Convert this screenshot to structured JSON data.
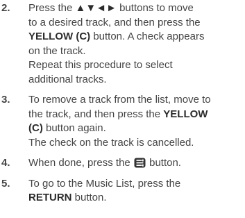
{
  "steps": [
    {
      "number": "2.",
      "text_a": "Press the ",
      "arrows": "▲▼◄►",
      "text_b": " buttons to move",
      "text_c": "to a desired track, and then press the",
      "yellow_label": "YELLOW (C)",
      "text_d": " button. A check appears",
      "text_e": "on the track.",
      "text_f": "Repeat this procedure to select",
      "text_g": "additional tracks."
    },
    {
      "number": "3.",
      "text_a": "To remove a track from the list, move to",
      "text_b": "the track, and then press the ",
      "yellow_label_a": "YELLOW",
      "yellow_label_b": "(C)",
      "text_c": " button again.",
      "text_d": "The check on the track is cancelled."
    },
    {
      "number": "4.",
      "text_a": "When done, press the ",
      "icon": "tools-menu-button-icon",
      "text_b": " button."
    },
    {
      "number": "5.",
      "text_a": "To go to the Music List, press the",
      "return_label": "RETURN",
      "text_b": " button."
    }
  ],
  "colors": {
    "text": "#444444",
    "icon_fill": "#333333"
  }
}
